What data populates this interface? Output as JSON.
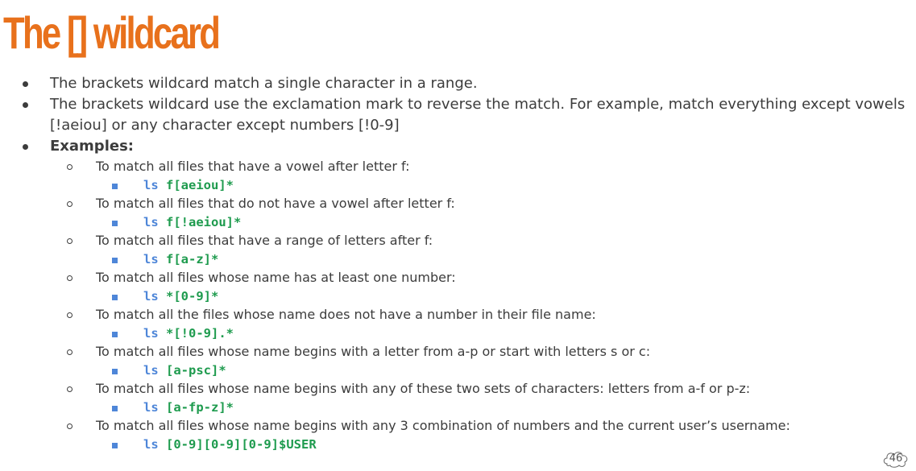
{
  "slide": {
    "title": "The [] wildcard",
    "page_number": "46",
    "bullets": [
      "The brackets wildcard match a single character in a range.",
      "The brackets wildcard use the exclamation mark to reverse the match. For example, match everything except vowels [!aeiou] or any character except numbers [!0-9]"
    ],
    "examples_label": "Examples:",
    "examples": [
      {
        "desc": "To match all files that have a vowel after letter f:",
        "cmd": "ls",
        "arg": "f[aeiou]*"
      },
      {
        "desc": "To match all files that do not have a vowel after letter f:",
        "cmd": "ls",
        "arg": "f[!aeiou]*"
      },
      {
        "desc": "To match all files that have a range of letters after f:",
        "cmd": "ls",
        "arg": "f[a-z]*"
      },
      {
        "desc": "To match all files whose name has at least one number:",
        "cmd": "ls",
        "arg": "*[0-9]*"
      },
      {
        "desc": "To match all the files whose name does not have a number in their file name:",
        "cmd": "ls",
        "arg": "*[!0-9].*"
      },
      {
        "desc": "To match all files whose name begins with a letter from a-p or start with letters s or c:",
        "cmd": "ls",
        "arg": "[a-psc]*"
      },
      {
        "desc": "To match all files whose name begins with any of these two sets of characters: letters from a-f or p-z:",
        "cmd": "ls",
        "arg": "[a-fp-z]*"
      },
      {
        "desc": "To match all files whose name begins with any 3 combination of numbers and the current user’s username:",
        "cmd": "ls",
        "arg": "[0-9][0-9][0-9]$USER"
      }
    ]
  }
}
